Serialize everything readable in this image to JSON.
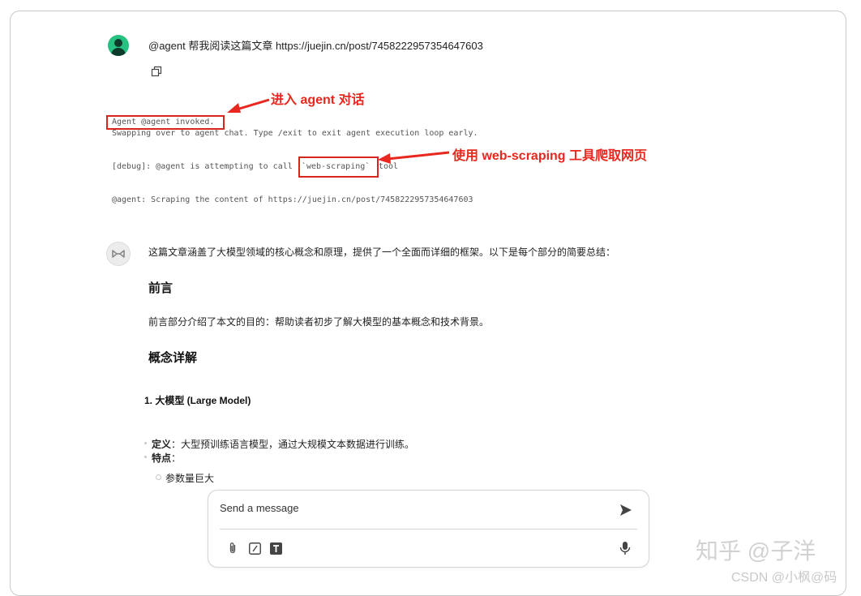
{
  "user_message": {
    "text": "@agent 帮我阅读这篇文章 https://juejin.cn/post/7458222957354647603"
  },
  "terminal": {
    "line1": "Agent @agent invoked.",
    "line2": "Swapping over to agent chat. Type /exit to exit agent execution loop early.",
    "line3_prefix": "[debug]: @agent is attempting to call",
    "line3_tool": "`web-scraping`",
    "line3_suffix": "tool",
    "line4": "@agent: Scraping the content of https://juejin.cn/post/7458222957354647603"
  },
  "annotations": {
    "agent_chat": "进入 agent 对话",
    "web_scraping": "使用 web-scraping 工具爬取网页",
    "color": "#e8281e"
  },
  "assistant": {
    "intro": "这篇文章涵盖了大模型领域的核心概念和原理，提供了一个全面而详细的框架。以下是每个部分的简要总结：",
    "section1_title": "前言",
    "section1_text": "前言部分介绍了本文的目的：帮助读者初步了解大模型的基本概念和技术背景。",
    "section2_title": "概念详解",
    "sub1_title": "1. 大模型 (Large Model)",
    "bullet1_label": "定义",
    "bullet1_text": "：大型预训练语言模型，通过大规模文本数据进行训练。",
    "bullet2_label": "特点",
    "bullet2_text": "：",
    "sub_bullet1": "参数量巨大"
  },
  "composer": {
    "placeholder": "Send a message"
  },
  "toolbar_icons": [
    "paperclip-icon",
    "slash-command-icon",
    "text-format-icon",
    "microphone-icon",
    "send-icon"
  ],
  "watermarks": {
    "zhihu": "知乎 @子洋",
    "csdn": "CSDN @小枫@码"
  }
}
